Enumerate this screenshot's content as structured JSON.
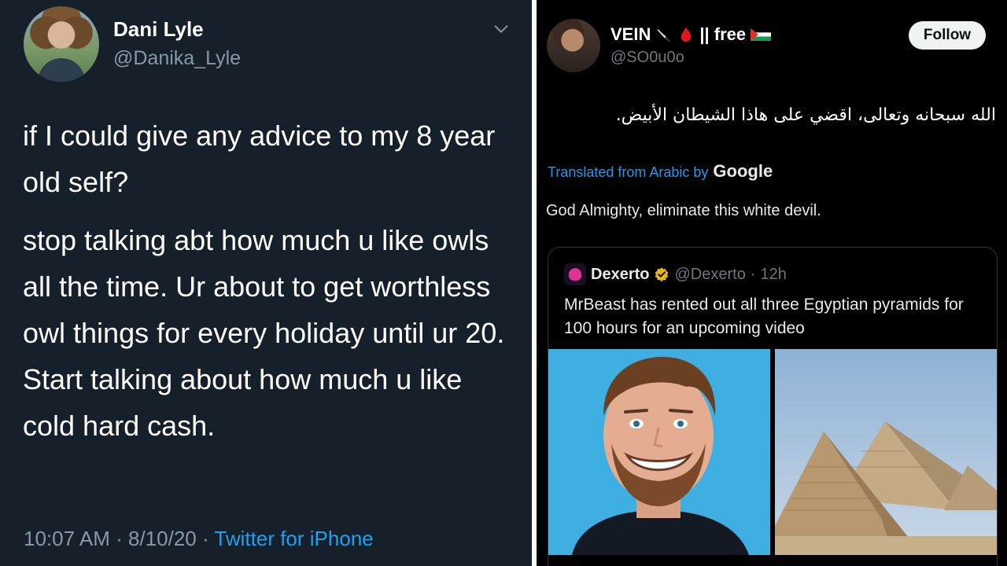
{
  "left_tweet": {
    "name": "Dani Lyle",
    "handle": "@Danika_Lyle",
    "paragraph1": "if I could give any advice to my 8 year old self?",
    "paragraph2": "stop talking abt how much u like owls all the time. Ur about to get worthless owl things for every holiday until ur 20. Start talking about how much u like cold hard cash.",
    "time": "10:07 AM",
    "date": "8/10/20",
    "separator": "·",
    "source": "Twitter for iPhone",
    "chevron_icon": "chevron-down-icon"
  },
  "right_tweet": {
    "name": "VEIN",
    "name_suffix": "|| free",
    "handle": "@SO0u0o",
    "follow_label": "Follow",
    "arabic_text": "الله سبحانه وتعالى، اقضي على هاذا الشيطان الأبيض.",
    "translated_label": "Translated from Arabic by",
    "translator": "Google",
    "translation": "God Almighty, eliminate this white devil.",
    "icons": [
      "knife-icon",
      "blood-drop-icon",
      "palestine-flag-icon"
    ],
    "quoted": {
      "name": "Dexerto",
      "handle": "@Dexerto",
      "separator": "·",
      "age": "12h",
      "text": "MrBeast has rented out all three Egyptian pyramids for 100 hours for an upcoming video",
      "images": [
        "person-photo",
        "pyramids-photo"
      ]
    }
  },
  "colors": {
    "left_bg": "#15202b",
    "right_bg": "#000000",
    "link_blue": "#1da1f2",
    "muted": "#8899a6",
    "verified_gold": "#e2b719",
    "blood_red": "#e0151f"
  }
}
